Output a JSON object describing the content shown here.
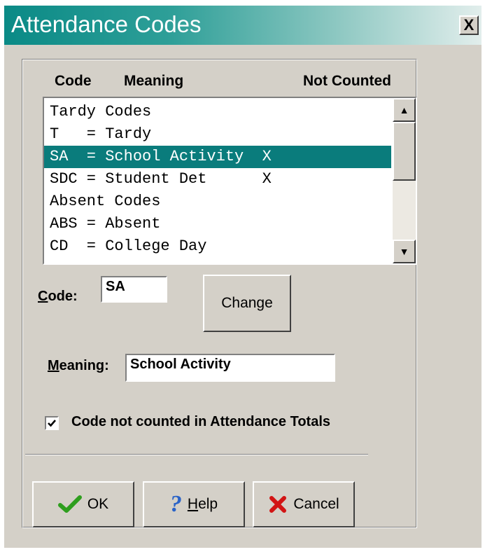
{
  "window": {
    "title": "Attendance Codes",
    "close_label": "X"
  },
  "list": {
    "headers": {
      "code": "Code",
      "meaning": "Meaning",
      "not_counted": "Not Counted"
    },
    "rows": [
      "Tardy Codes",
      "T   = Tardy",
      "SA  = School Activity  X",
      "SDC = Student Det      X",
      "Absent Codes",
      "ABS = Absent",
      "CD  = College Day"
    ],
    "selected_index": 2
  },
  "form": {
    "code_label_key": "C",
    "code_label_rest": "ode:",
    "code_value": "SA",
    "change_label": "Change",
    "meaning_label_key": "M",
    "meaning_label_rest": "eaning:",
    "meaning_value": "School Activity",
    "not_counted_label": "Code not counted in Attendance Totals",
    "not_counted_checked": true
  },
  "buttons": {
    "ok_label": "OK",
    "help_key": "H",
    "help_rest": "elp",
    "cancel_label": "Cancel"
  },
  "colors": {
    "title_bar": "#0a8a86",
    "selection": "#0a7c7c",
    "dialog_bg": "#d4d0c8"
  }
}
